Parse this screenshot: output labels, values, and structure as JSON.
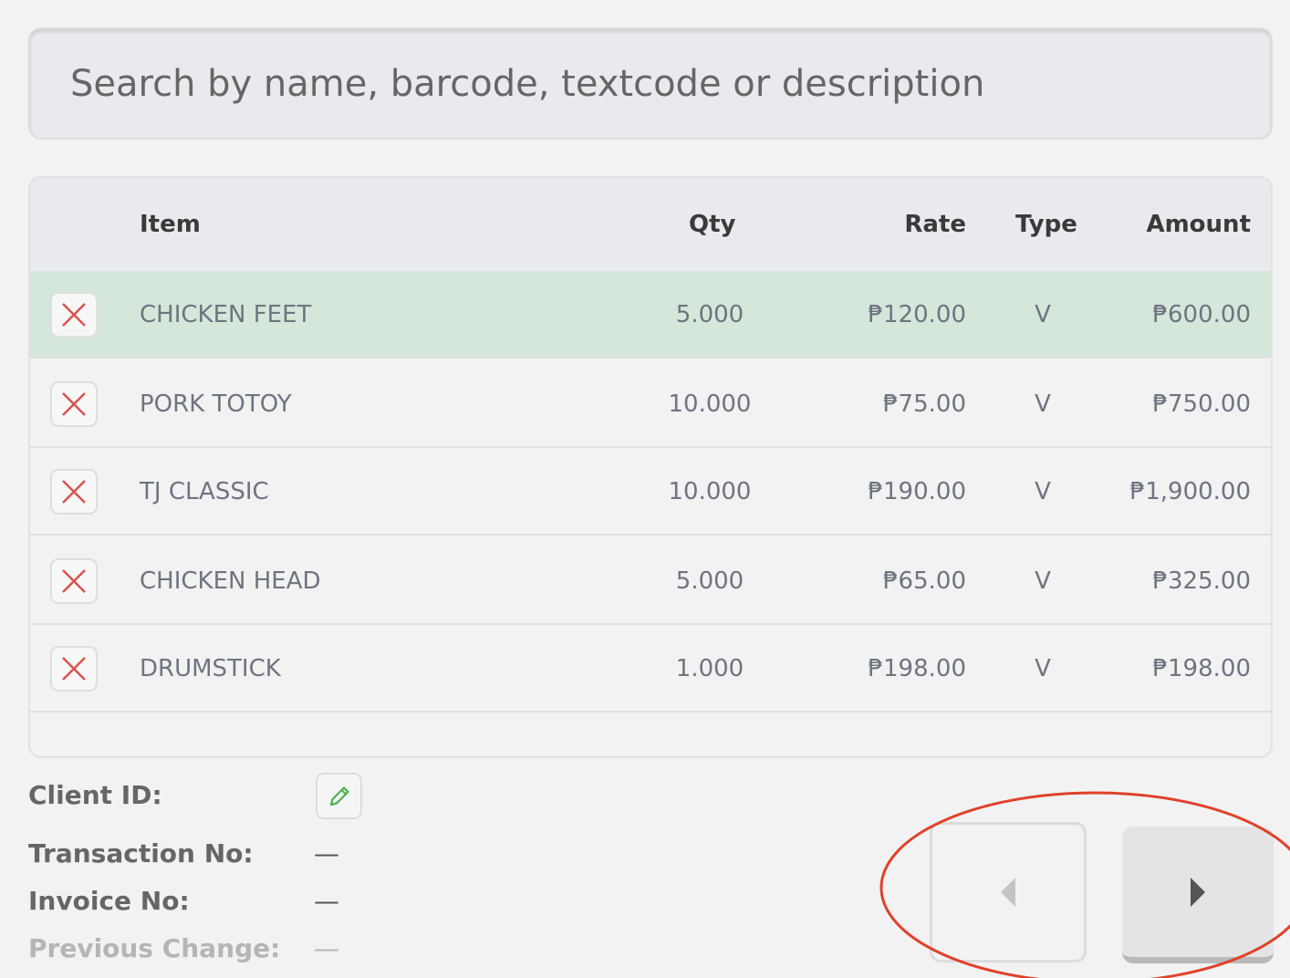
{
  "search": {
    "placeholder": "Search by name, barcode, textcode or description"
  },
  "table": {
    "columns": {
      "item": "Item",
      "qty": "Qty",
      "rate": "Rate",
      "type": "Type",
      "amount": "Amount"
    },
    "rows": [
      {
        "item": "CHICKEN FEET",
        "qty": "5.000",
        "rate": "₱120.00",
        "type": "V",
        "amount": "₱600.00",
        "selected": true
      },
      {
        "item": "PORK TOTOY",
        "qty": "10.000",
        "rate": "₱75.00",
        "type": "V",
        "amount": "₱750.00",
        "selected": false
      },
      {
        "item": "TJ CLASSIC",
        "qty": "10.000",
        "rate": "₱190.00",
        "type": "V",
        "amount": "₱1,900.00",
        "selected": false
      },
      {
        "item": "CHICKEN HEAD",
        "qty": "5.000",
        "rate": "₱65.00",
        "type": "V",
        "amount": "₱325.00",
        "selected": false
      },
      {
        "item": "DRUMSTICK",
        "qty": "1.000",
        "rate": "₱198.00",
        "type": "V",
        "amount": "₱198.00",
        "selected": false
      }
    ]
  },
  "info": {
    "client_id_label": "Client ID:",
    "transaction_no_label": "Transaction No:",
    "transaction_no_value": "—",
    "invoice_no_label": "Invoice No:",
    "invoice_no_value": "—",
    "previous_change_label": "Previous Change:",
    "previous_change_value": "—"
  },
  "icons": {
    "delete": "close-icon",
    "edit": "pencil-icon",
    "prev": "triangle-left-icon",
    "next": "triangle-right-icon"
  },
  "colors": {
    "selected_row": "#d5e7da",
    "delete_x": "#d9534f",
    "edit_pencil": "#4caf50",
    "annotation": "#e0412c"
  }
}
